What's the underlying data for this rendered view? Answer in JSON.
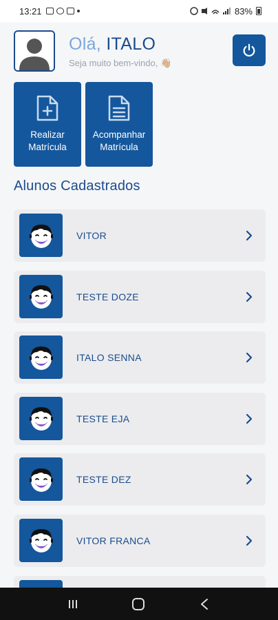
{
  "status_bar": {
    "time": "13:21",
    "battery": "83%"
  },
  "header": {
    "greeting_prefix": "Olá,",
    "user_name": "ITALO",
    "subtitle": "Seja muito bem-vindo, 👋🏼"
  },
  "actions": [
    {
      "label": "Realizar\nMatrícula",
      "icon": "file-add-icon"
    },
    {
      "label": "Acompanhar\nMatrícula",
      "icon": "document-list-icon"
    }
  ],
  "section_title": "Alunos Cadastrados",
  "students": [
    {
      "name": "VITOR"
    },
    {
      "name": "TESTE DOZE"
    },
    {
      "name": "ITALO SENNA"
    },
    {
      "name": "TESTE EJA"
    },
    {
      "name": "TESTE DEZ"
    },
    {
      "name": "VITOR FRANCA"
    },
    {
      "name": ""
    }
  ],
  "colors": {
    "primary": "#14579c",
    "title": "#1a4b8c",
    "accent_light": "#7ba7dd",
    "row_bg": "#ececee"
  }
}
